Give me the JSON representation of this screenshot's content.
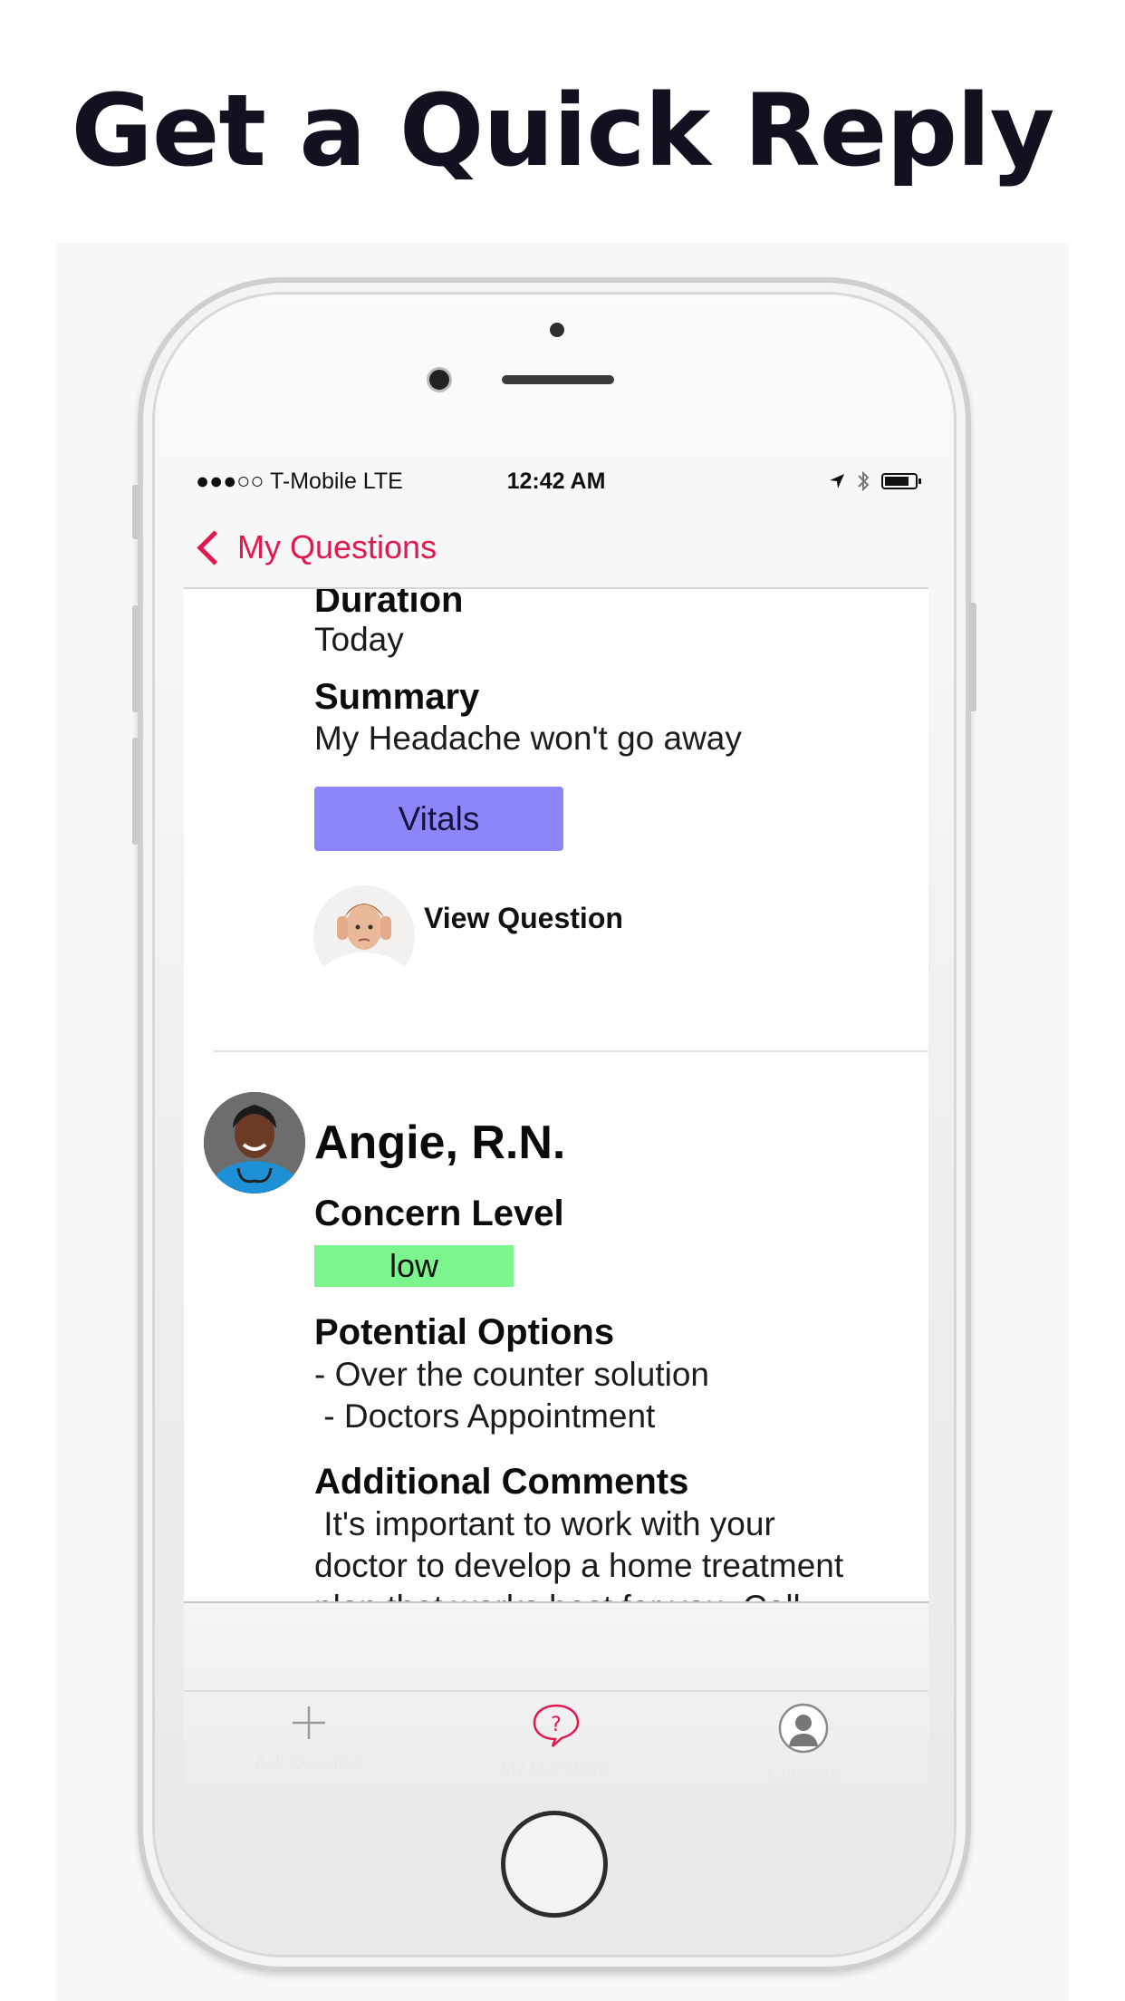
{
  "headline": "Get a Quick Reply",
  "status_bar": {
    "carrier": "●●●○○ T-Mobile  LTE",
    "time": "12:42 AM",
    "icons": [
      "location-arrow-icon",
      "bluetooth-icon",
      "battery-icon"
    ]
  },
  "nav": {
    "back_label": "My Questions"
  },
  "question": {
    "duration_label": "Duration",
    "duration_value": "Today",
    "summary_label": "Summary",
    "summary_value": "My Headache won't go away",
    "vitals_button": "Vitals",
    "view_question": "View Question"
  },
  "reply": {
    "name": "Angie, R.N.",
    "concern_label": "Concern Level",
    "concern_value": "low",
    "options_label": "Potential Options",
    "options": [
      "- Over the counter solution",
      " - Doctors Appointment"
    ],
    "comments_label": "Additional Comments",
    "comments_line1": " It's important to work with your",
    "comments_line2": "doctor to develop a home treatment",
    "comments_line3": "plan that works best for you. Call"
  },
  "tabs": [
    {
      "label": "Ask Question",
      "icon": "plus-icon",
      "active": false
    },
    {
      "label": "My Questions",
      "icon": "question-bubble-icon",
      "active": true
    },
    {
      "label": "Contacts",
      "icon": "contact-silhouette-icon",
      "active": false
    }
  ],
  "colors": {
    "accent": "#e2184e",
    "vitals": "#8c86fa",
    "concern_low": "#7cf58f"
  }
}
